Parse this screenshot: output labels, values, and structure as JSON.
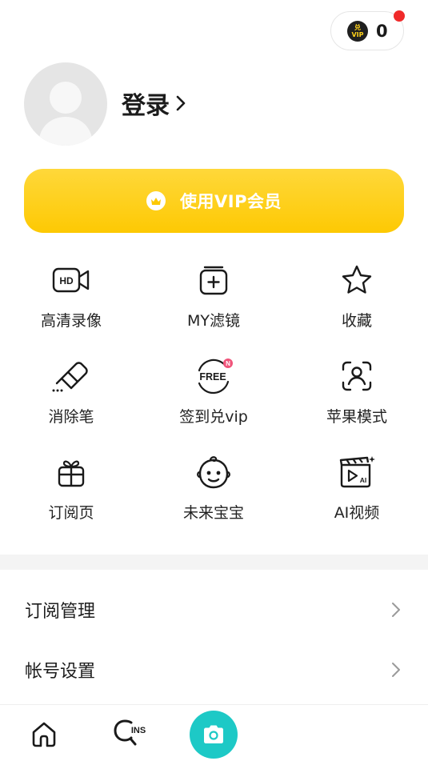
{
  "vip_badge": {
    "coin_line1": "兑",
    "coin_line2": "VIP",
    "count": "0"
  },
  "profile": {
    "login_label": "登录"
  },
  "vip_cta": {
    "label": "使用VIP会员"
  },
  "features": [
    {
      "label": "高清录像",
      "icon": "hd-video-icon",
      "badge": "HD"
    },
    {
      "label": "MY滤镜",
      "icon": "filter-plus-icon"
    },
    {
      "label": "收藏",
      "icon": "star-icon"
    },
    {
      "label": "消除笔",
      "icon": "eraser-icon"
    },
    {
      "label": "签到兑vip",
      "icon": "free-checkin-icon",
      "badge": "FREE",
      "new_badge": "N"
    },
    {
      "label": "苹果模式",
      "icon": "face-scan-icon"
    },
    {
      "label": "订阅页",
      "icon": "gift-icon"
    },
    {
      "label": "未来宝宝",
      "icon": "baby-face-icon"
    },
    {
      "label": "AI视频",
      "icon": "ai-video-icon",
      "badge": "AI"
    }
  ],
  "menu": [
    {
      "label": "订阅管理"
    },
    {
      "label": "帐号设置"
    }
  ],
  "tabs": {
    "ins_label": "INS"
  },
  "colors": {
    "accent_yellow": "#fdc903",
    "camera_teal": "#1dc9c6",
    "dot_red": "#f02a2a",
    "new_badge_pink": "#f0547a"
  }
}
